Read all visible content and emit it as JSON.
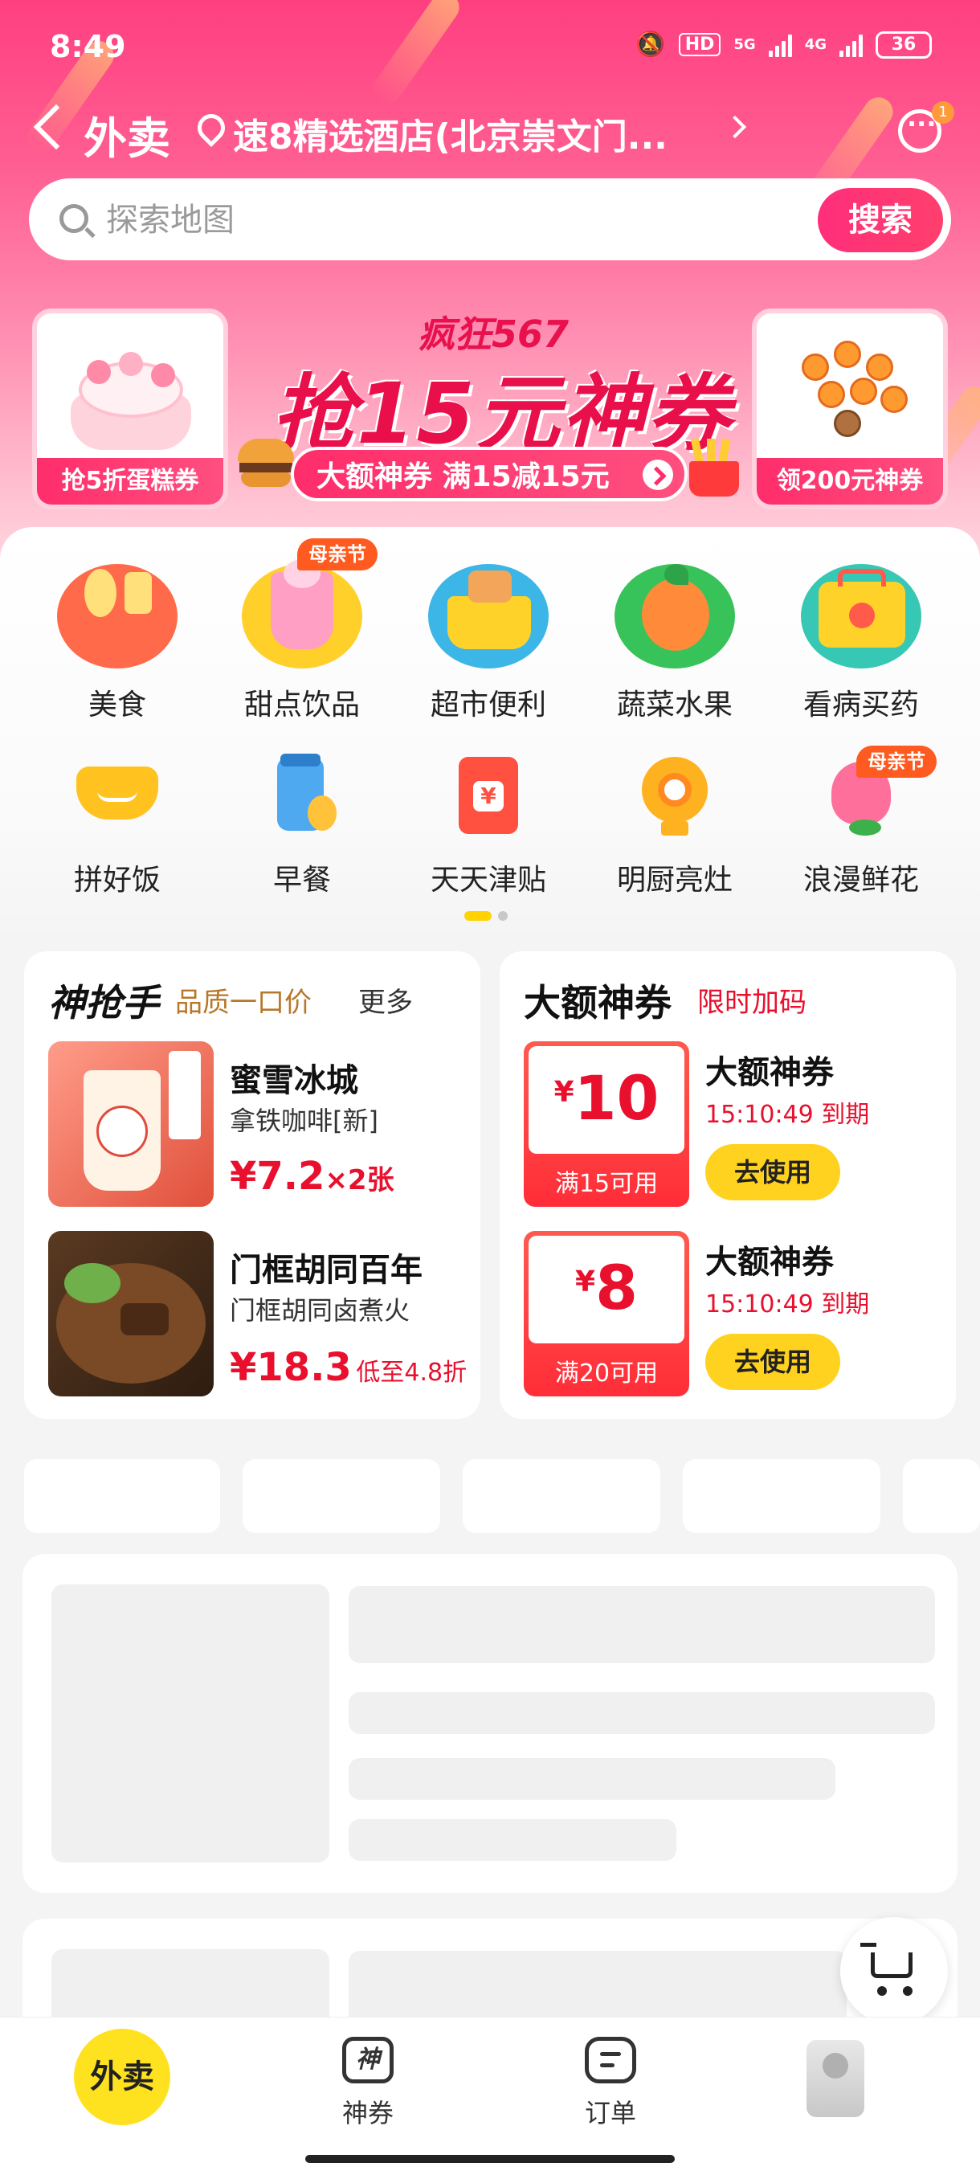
{
  "status_bar": {
    "time": "8:49",
    "network_hd": "HD",
    "network_5g": "5G",
    "network_4g": "4G",
    "battery": "36"
  },
  "header": {
    "title": "外卖",
    "address": "速8精选酒店(北京崇文门...",
    "message_badge": "1"
  },
  "search": {
    "placeholder": "探索地图",
    "button_label": "搜索"
  },
  "banner": {
    "left_tag": "抢5折蛋糕券",
    "right_tag": "领200元神券",
    "promo_subtitle": "疯狂567",
    "promo_title": "抢15元神券",
    "promo_pill": "大额神券 满15减15元"
  },
  "categories": [
    {
      "label": "美食",
      "icon": "tableware-icon"
    },
    {
      "label": "甜点饮品",
      "icon": "dessert-icon",
      "tag": "母亲节"
    },
    {
      "label": "超市便利",
      "icon": "basket-icon"
    },
    {
      "label": "蔬菜水果",
      "icon": "fruit-icon"
    },
    {
      "label": "看病买药",
      "icon": "medical-kit-icon"
    },
    {
      "label": "拼好饭",
      "icon": "rice-bowl-icon"
    },
    {
      "label": "早餐",
      "icon": "milk-bottle-icon"
    },
    {
      "label": "天天津贴",
      "icon": "red-envelope-icon"
    },
    {
      "label": "明厨亮灶",
      "icon": "camera-icon"
    },
    {
      "label": "浪漫鲜花",
      "icon": "flower-icon",
      "tag": "母亲节"
    }
  ],
  "deals": {
    "title": "神抢手",
    "subtitle": "品质一口价",
    "more": "更多",
    "items": [
      {
        "store": "蜜雪冰城",
        "product": "拿铁咖啡[新]",
        "price": "¥7.2",
        "note": "×2张"
      },
      {
        "store": "门框胡同百年",
        "product": "门框胡同卤煮火",
        "price": "¥18.3",
        "note": "低至4.8折"
      }
    ]
  },
  "coupons": {
    "title": "大额神券",
    "subtitle": "限时加码",
    "items": [
      {
        "amount": "10",
        "currency": "¥",
        "condition": "满15可用",
        "name": "大额神券",
        "expiry": "15:10:49 到期",
        "button": "去使用"
      },
      {
        "amount": "8",
        "currency": "¥",
        "condition": "满20可用",
        "name": "大额神券",
        "expiry": "15:10:49 到期",
        "button": "去使用"
      }
    ]
  },
  "tabbar": {
    "home": "外卖",
    "coupons": "神券",
    "coupons_icon_text": "神",
    "orders": "订单"
  },
  "colors": {
    "brand_pink": "#ff3f80",
    "accent_yellow": "#ffd21f",
    "price_red": "#e8102d"
  }
}
